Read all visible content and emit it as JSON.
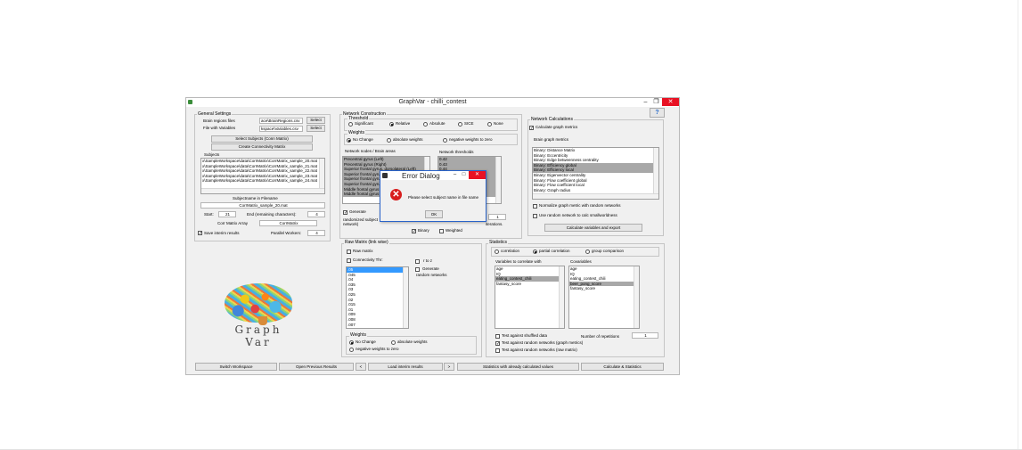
{
  "window": {
    "title": "GraphVar - chilli_contest",
    "min": "–",
    "max": "❐",
    "close": "✕",
    "help": "?"
  },
  "general": {
    "title": "General Settings",
    "brain_regions_label": "Brain regions files",
    "brain_regions_value": "ace\\BrainRegions.csv",
    "variables_label": "File with Variables",
    "variables_value": "kspace\\Variables.csv",
    "select_btn": "Select",
    "select_subjects_btn": "Select Subjects (Conn Matrix)",
    "create_conn_btn": "Create Connectivity Matrix",
    "subjects_title": "Subjects",
    "subjects": [
      "x\\SampleWorkspace\\data\\CorrMatrix\\CorrMatrix_sample_20.mat",
      "x\\SampleWorkspace\\data\\CorrMatrix\\CorrMatrix_sample_21.mat",
      "x\\SampleWorkspace\\data\\CorrMatrix\\CorrMatrix_sample_22.mat",
      "x\\SampleWorkspace\\data\\CorrMatrix\\CorrMatrix_sample_23.mat",
      "x\\SampleWorkspace\\data\\CorrMatrix\\CorrMatrix_sample_24.mat"
    ],
    "subjectname_label": "Subjectname in Filename",
    "subjectname_value": "CorrMatrix_sample_20.mat",
    "start_label": "Start:",
    "start_value": "21",
    "end_label": "End (remaining characters):",
    "end_value": "4",
    "array_label": "Corr Matrix Array",
    "array_value": "CorrMatrix",
    "save_interim": "Save interim results",
    "workers_label": "Parallel Workers:",
    "workers_value": "4"
  },
  "logo": {
    "text": "Graph Var"
  },
  "network": {
    "title": "Network Construction",
    "threshold_title": "Threshold",
    "thresholds": [
      "Significant",
      "Relative",
      "Absolute",
      "SICE",
      "None"
    ],
    "threshold_selected": "Relative",
    "weights_title": "Weights",
    "weights": [
      "No Change",
      "absolute weights",
      "negative weights to zero"
    ],
    "nodes_label": "Network nodes / Brain areas",
    "nodes": [
      "Precentral gyrus (Left)",
      "Precentral gyrus (Right)",
      "Superior frontal gyrus, dorsolateral (Left)",
      "Superior frontal gyrus, dorsolateral (Right)",
      "Superior frontal gyrus, orbital (Left)",
      "Superior frontal gyrus, orbital (Right)",
      "Middle frontal gyrus (Left)",
      "Middle frontal gyrus (Right)"
    ],
    "thr_label": "Network thresholds",
    "thr_values": [
      "0.42",
      "0.43",
      "0.44",
      "0.45",
      "0.46",
      "0.47",
      "0.48",
      "0.49"
    ],
    "generate_label": "Generate",
    "randomized_text": "randomized subject network)",
    "iterations_text": "iterations.",
    "iter_value": "1",
    "binary": "Binary",
    "weighted": "Weighted"
  },
  "calc": {
    "title": "Network Calculations",
    "calc_graph": "Calculate graph metrics",
    "metrics_label": "Brain graph metrics",
    "metrics": [
      "Binary: Distance Matrix",
      "Binary: Eccentricity",
      "Binary: Edge betweenness centrality",
      "Binary: Efficiency global",
      "Binary: Efficiency local",
      "Binary: Eigenvector centrality",
      "Binary: Flow coefficient global",
      "Binary: Flow coefficient local",
      "Binary: Graph radius"
    ],
    "normalize": "Normalize graph metric with random networks",
    "use_random": "Use random network to calc smallworldness",
    "export_btn": "Calculate variables and export"
  },
  "raw": {
    "title": "Raw Matrix (link wise)",
    "raw_matrix": "Raw matrix",
    "conn_thr": "Connectivity Thr:",
    "r_to_z": "r to z",
    "generate": "Generate",
    "random_networks": "random networks",
    "values": [
      ".05",
      ".045",
      ".04",
      ".035",
      ".03",
      ".025",
      ".02",
      ".015",
      ".01",
      ".009",
      ".008",
      ".007"
    ],
    "weights_title": "Weights",
    "w_no_change": "No Change",
    "w_absolute": "absolute weights",
    "w_negative": "negative weights to zero"
  },
  "stats": {
    "title": "Statistics",
    "modes": [
      "correlation",
      "partial correlation",
      "group comparison"
    ],
    "mode_selected": "partial correlation",
    "vars_label": "Variables to correlate with",
    "vars": [
      "age",
      "IQ",
      "eating_contest_chili",
      "fantasy_score"
    ],
    "cov_label": "Covariables",
    "covs": [
      "age",
      "IQ",
      "eating_contest_chili",
      "beer_pong_score",
      "fantasy_score"
    ],
    "shuffled": "Test against shuffled data",
    "reps_label": "Number of repetitions",
    "reps_value": "1",
    "random_graph": "Test against random networks (graph metrics)",
    "random_raw": "Test against random networks (raw matrix)"
  },
  "bottom": {
    "switch": "Switch Workspace",
    "open_prev": "Open Previous Results",
    "prev": "<",
    "load_interim": "Load interim results",
    "next": ">",
    "stats_calc": "Statistics with already calculated values",
    "calc_stats": "Calculate & Statistics"
  },
  "dialog": {
    "title": "Error Dialog",
    "message": "Please select subject name in file name",
    "ok": "OK",
    "min": "–",
    "max": "□",
    "close": "✕"
  }
}
